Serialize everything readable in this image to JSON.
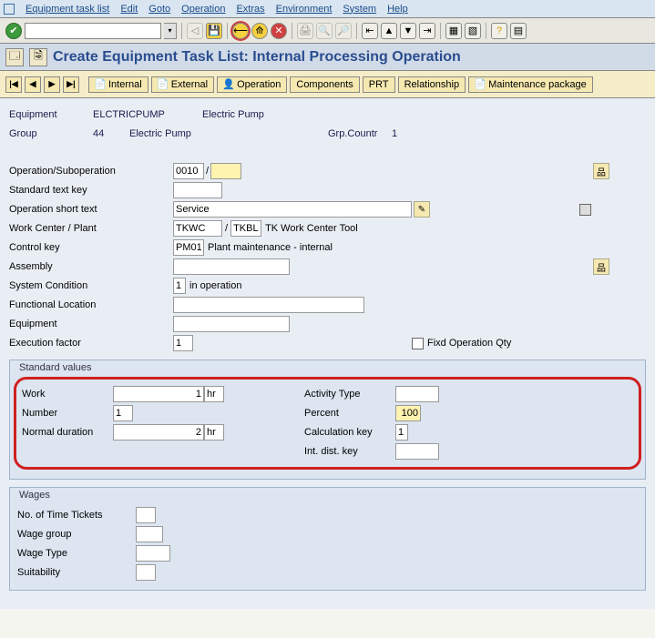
{
  "menu": {
    "items": [
      "Equipment task list",
      "Edit",
      "Goto",
      "Operation",
      "Extras",
      "Environment",
      "System",
      "Help"
    ]
  },
  "title": "Create Equipment Task List: Internal Processing Operation",
  "tabs": {
    "internal": "Internal",
    "external": "External",
    "operation": "Operation",
    "components": "Components",
    "prt": "PRT",
    "relationship": "Relationship",
    "maintpkg": "Maintenance package"
  },
  "header": {
    "equipment_lbl": "Equipment",
    "equipment_val": "ELCTRICPUMP",
    "equipment_desc": "Electric Pump",
    "group_lbl": "Group",
    "group_val": "44",
    "group_desc": "Electric Pump",
    "grpcountr_lbl": "Grp.Countr",
    "grpcountr_val": "1"
  },
  "fields": {
    "op_lbl": "Operation/Suboperation",
    "op_val": "0010",
    "op_sep": "/",
    "subop_val": "",
    "stdtext_lbl": "Standard text key",
    "stdtext_val": "",
    "shorttext_lbl": "Operation short text",
    "shorttext_val": "Service",
    "wc_lbl": "Work Center / Plant",
    "wc_val": "TKWC",
    "wc_sep": "/",
    "plant_val": "TKBL",
    "wc_desc": "TK Work Center Tool",
    "ctrlkey_lbl": "Control key",
    "ctrlkey_val": "PM01",
    "ctrlkey_desc": "Plant maintenance - internal",
    "assembly_lbl": "Assembly",
    "assembly_val": "",
    "syscond_lbl": "System Condition",
    "syscond_val": "1",
    "syscond_desc": "in operation",
    "funcloc_lbl": "Functional Location",
    "funcloc_val": "",
    "equip_lbl": "Equipment",
    "equip_val": "",
    "execf_lbl": "Execution factor",
    "execf_val": "1",
    "fixedqty_lbl": "Fixd Operation Qty"
  },
  "stdvals": {
    "title": "Standard values",
    "work_lbl": "Work",
    "work_val": "1",
    "work_unit": "hr",
    "number_lbl": "Number",
    "number_val": "1",
    "normdur_lbl": "Normal duration",
    "normdur_val": "2",
    "normdur_unit": "hr",
    "acttype_lbl": "Activity Type",
    "acttype_val": "",
    "percent_lbl": "Percent",
    "percent_val": "100",
    "calckey_lbl": "Calculation key",
    "calckey_val": "1",
    "intdist_lbl": "Int. dist. key",
    "intdist_val": ""
  },
  "wages": {
    "title": "Wages",
    "tickets_lbl": "No. of Time Tickets",
    "tickets_val": "",
    "wgroup_lbl": "Wage group",
    "wgroup_val": "",
    "wtype_lbl": "Wage Type",
    "wtype_val": "",
    "suit_lbl": "Suitability",
    "suit_val": ""
  }
}
